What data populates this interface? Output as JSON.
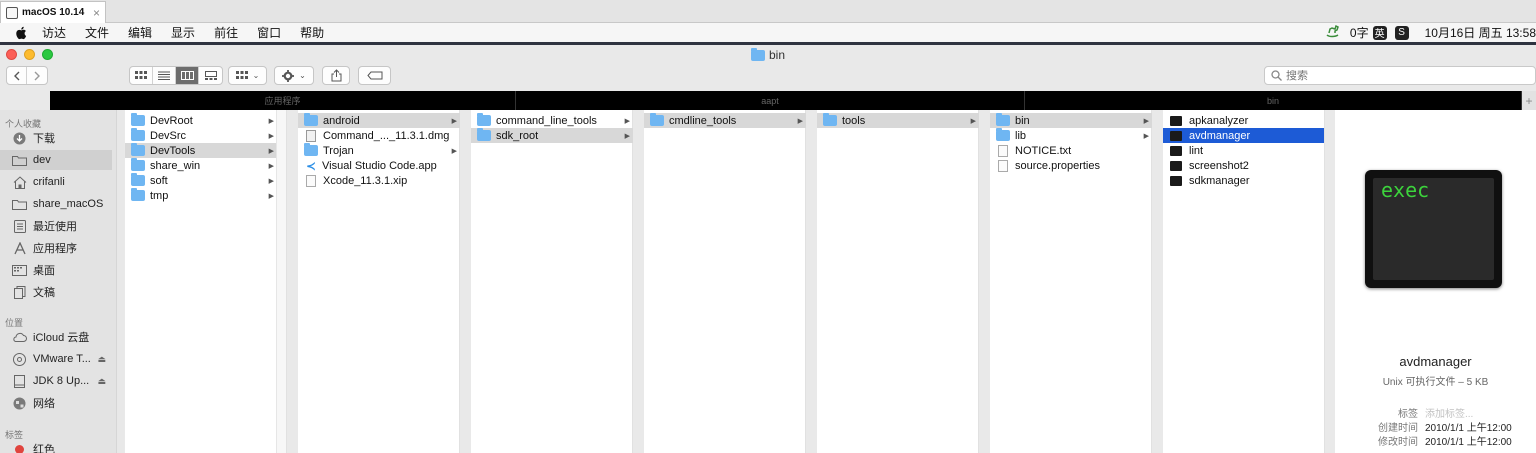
{
  "vm": {
    "tab_title": "macOS 10.14",
    "close": "×"
  },
  "menubar": {
    "items": [
      "访达",
      "文件",
      "编辑",
      "显示",
      "前往",
      "窗口",
      "帮助"
    ],
    "input_status": "0字",
    "ime": "英",
    "ime2": "S",
    "clock": "10月16日 周五  13:58"
  },
  "window": {
    "title": "bin"
  },
  "toolbar": {
    "search_placeholder": "搜索"
  },
  "pathbar": {
    "items": [
      "应用程序",
      "aapt",
      "bin"
    ],
    "plus": "+"
  },
  "sidebar": {
    "favorites_header": "个人收藏",
    "favorites": [
      "下载",
      "dev",
      "crifanli",
      "share_macOS",
      "最近使用",
      "应用程序",
      "桌面",
      "文稿"
    ],
    "locations_header": "位置",
    "locations": [
      "iCloud 云盘",
      "VMware T...",
      "JDK 8 Up...",
      "网络"
    ],
    "tags_header": "标签",
    "tags": [
      "红色"
    ]
  },
  "columns": {
    "c1": [
      "DevRoot",
      "DevSrc",
      "DevTools",
      "share_win",
      "soft",
      "tmp"
    ],
    "c2": [
      "android",
      "Command_..._11.3.1.dmg",
      "Trojan",
      "Visual Studio Code.app",
      "Xcode_11.3.1.xip"
    ],
    "c3": [
      "command_line_tools",
      "sdk_root"
    ],
    "c4": [
      "cmdline_tools"
    ],
    "c5": [
      "tools"
    ],
    "c6": [
      "bin",
      "lib",
      "NOTICE.txt",
      "source.properties"
    ],
    "c7": [
      "apkanalyzer",
      "avdmanager",
      "lint",
      "screenshot2",
      "sdkmanager"
    ]
  },
  "preview": {
    "icon_text": "exec",
    "name": "avdmanager",
    "kind": "Unix 可执行文件 – 5 KB",
    "tags_label": "标签",
    "tags_placeholder": "添加标签...",
    "created_label": "创建时间",
    "created": "2010/1/1 上午12:00",
    "modified_label": "修改时间",
    "modified": "2010/1/1 上午12:00"
  }
}
